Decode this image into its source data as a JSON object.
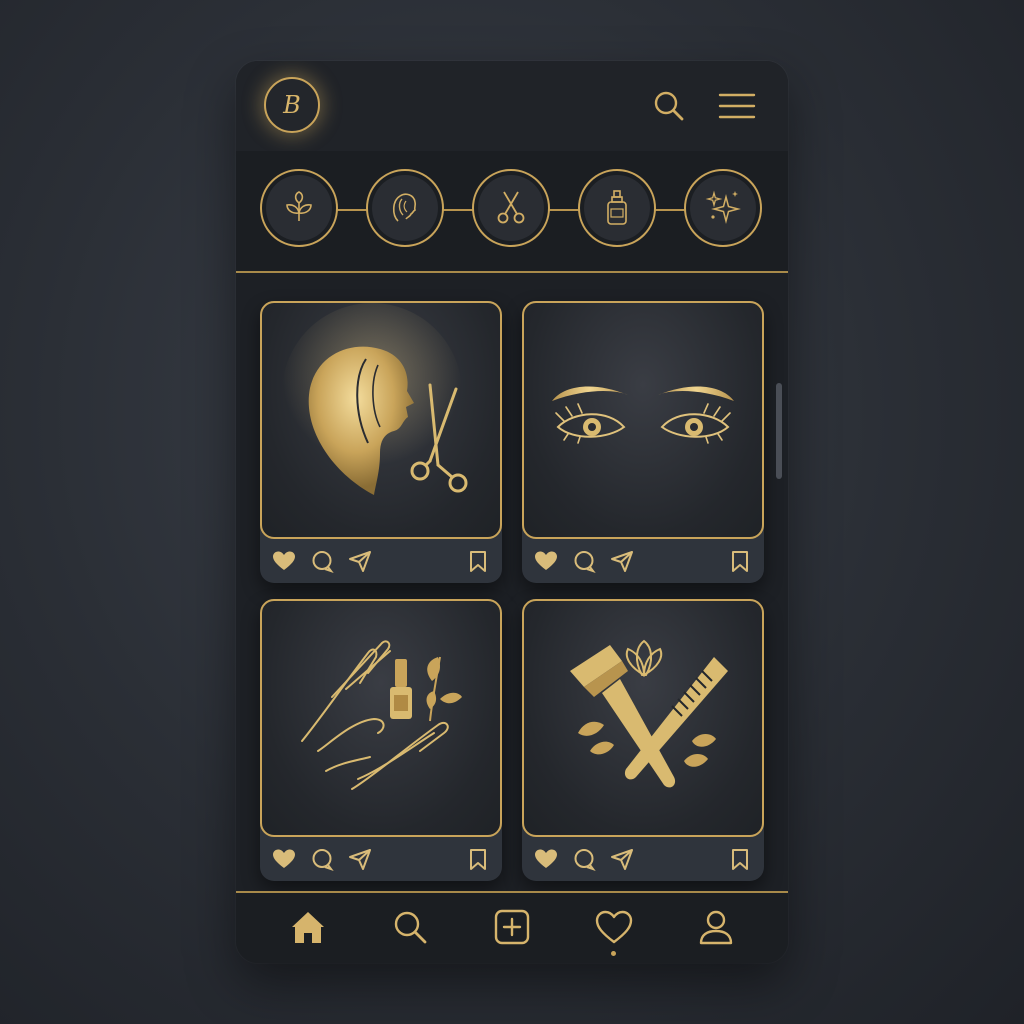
{
  "header": {
    "logo_letter": "B",
    "search_icon": "search-icon",
    "menu_icon": "hamburger-menu-icon"
  },
  "stories": [
    {
      "icon": "leaf-sprout-icon"
    },
    {
      "icon": "woman-profile-icon"
    },
    {
      "icon": "scissors-icon"
    },
    {
      "icon": "spray-bottle-icon"
    },
    {
      "icon": "sparkles-icon"
    }
  ],
  "posts": [
    {
      "image": "hair-woman-scissors",
      "actions": [
        "heart-icon",
        "comment-icon",
        "share-icon",
        "bookmark-icon"
      ]
    },
    {
      "image": "eyes-brows-lashes",
      "actions": [
        "heart-icon",
        "comment-icon",
        "share-icon",
        "bookmark-icon"
      ]
    },
    {
      "image": "hands-nail-polish-leaves",
      "actions": [
        "heart-icon",
        "comment-icon",
        "share-icon",
        "bookmark-icon"
      ]
    },
    {
      "image": "brush-comb-lotus",
      "actions": [
        "heart-icon",
        "comment-icon",
        "share-icon",
        "bookmark-icon"
      ]
    }
  ],
  "bottom_nav": [
    {
      "icon": "home-icon",
      "active": true
    },
    {
      "icon": "search-icon"
    },
    {
      "icon": "add-post-icon"
    },
    {
      "icon": "heart-icon",
      "indicator": true
    },
    {
      "icon": "profile-icon"
    }
  ],
  "colors": {
    "gold": "#c9a45a",
    "gold_light": "#e3c57c",
    "background": "#1d2025",
    "card": "#2f343c"
  }
}
